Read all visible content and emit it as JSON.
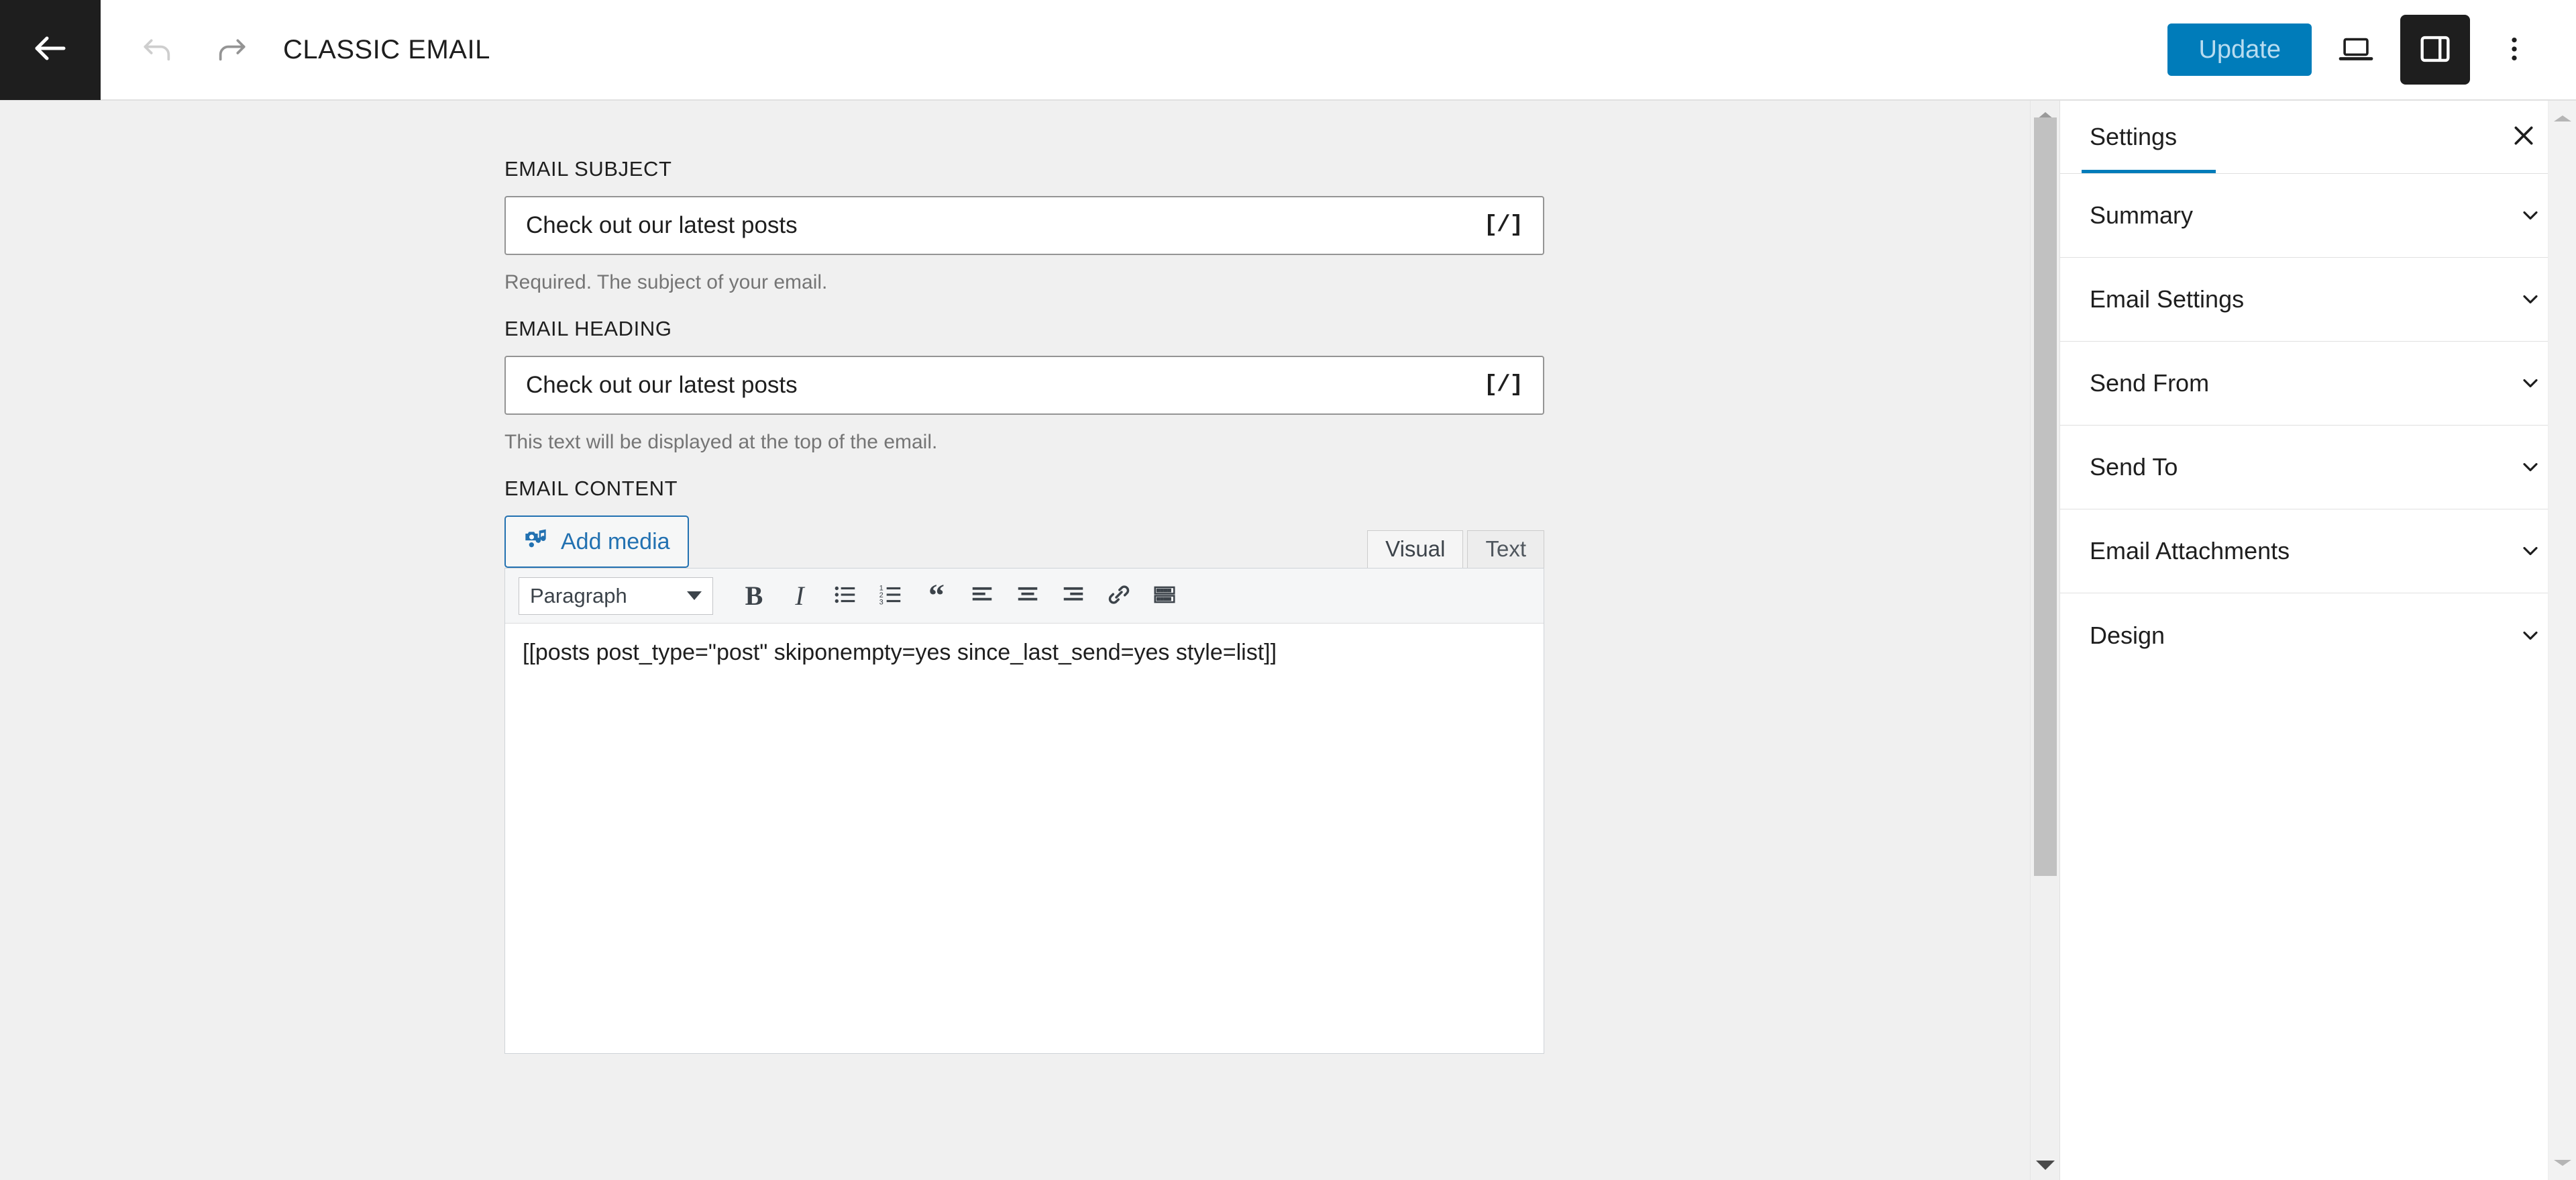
{
  "header": {
    "back_icon": "arrow-left-icon",
    "undo_icon": "undo-icon",
    "redo_icon": "redo-icon",
    "title": "CLASSIC EMAIL",
    "update_label": "Update",
    "preview_icon": "laptop-preview-icon",
    "sidebar_toggle_icon": "sidebar-panel-icon",
    "more_icon": "three-dots-vertical-icon",
    "accent_color": "#007cba",
    "update_text_color": "#b8dcf0",
    "dark_color": "#1e1e1e"
  },
  "main": {
    "subject": {
      "label": "EMAIL SUBJECT",
      "value": "Check out our latest posts",
      "placeholder": "Check out our latest posts",
      "shortcode_icon_label": "[/]",
      "help": "Required. The subject of your email."
    },
    "heading": {
      "label": "EMAIL HEADING",
      "value": "Check out our latest posts",
      "placeholder": "Check out our latest posts",
      "shortcode_icon_label": "[/]",
      "help": "This text will be displayed at the top of the email."
    },
    "content": {
      "label": "EMAIL CONTENT",
      "add_media_label": "Add media",
      "tabs": [
        {
          "label": "Visual",
          "active": true
        },
        {
          "label": "Text",
          "active": false
        }
      ],
      "toolbar": {
        "format_select_value": "Paragraph",
        "buttons": [
          {
            "name": "bold-icon",
            "glyph": "B"
          },
          {
            "name": "italic-icon",
            "glyph": "I"
          },
          {
            "name": "bulleted-list-icon",
            "glyph": ""
          },
          {
            "name": "numbered-list-icon",
            "glyph": ""
          },
          {
            "name": "blockquote-icon",
            "glyph": "“"
          },
          {
            "name": "align-left-icon",
            "glyph": ""
          },
          {
            "name": "align-center-icon",
            "glyph": ""
          },
          {
            "name": "align-right-icon",
            "glyph": ""
          },
          {
            "name": "insert-link-icon",
            "glyph": ""
          },
          {
            "name": "toolbar-toggle-icon",
            "glyph": ""
          }
        ]
      },
      "body_text": "[[posts post_type=\"post\" skiponempty=yes since_last_send=yes style=list]]"
    }
  },
  "settings": {
    "tab_label": "Settings",
    "close_icon": "close-icon",
    "sections": [
      {
        "label": "Summary"
      },
      {
        "label": "Email Settings"
      },
      {
        "label": "Send From"
      },
      {
        "label": "Send To"
      },
      {
        "label": "Email Attachments"
      },
      {
        "label": "Design"
      }
    ]
  },
  "scrollbars": {
    "main_up_icon": "scroll-up-arrow-icon",
    "main_down_icon": "scroll-down-arrow-icon",
    "panel_up_icon": "scroll-up-arrow-icon",
    "panel_down_icon": "scroll-down-arrow-icon"
  }
}
